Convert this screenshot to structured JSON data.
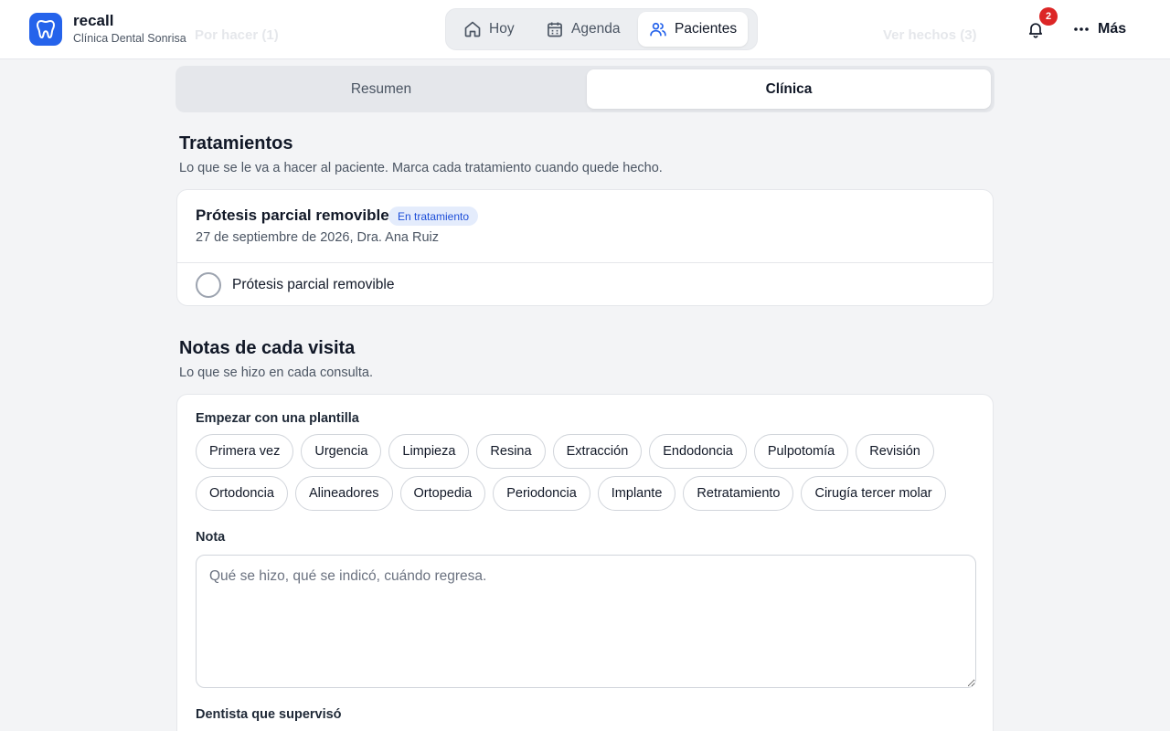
{
  "app": {
    "name": "recall",
    "clinic": "Clínica Dental Sonrisa"
  },
  "background": {
    "behind_left": "Por hacer (1)",
    "behind_right": "Ver hechos (3)"
  },
  "nav": {
    "items": [
      {
        "label": "Hoy",
        "icon": "home-icon"
      },
      {
        "label": "Agenda",
        "icon": "calendar-icon"
      },
      {
        "label": "Pacientes",
        "icon": "users-icon",
        "active": true
      }
    ]
  },
  "header_right": {
    "notifications_count": "2",
    "more_label": "Más"
  },
  "tabs": [
    {
      "label": "Resumen",
      "active": false
    },
    {
      "label": "Clínica",
      "active": true
    }
  ],
  "treatments": {
    "title": "Tratamientos",
    "subtitle": "Lo que se le va a hacer al paciente. Marca cada tratamiento cuando quede hecho.",
    "card": {
      "name": "Prótesis parcial removible",
      "status": "En tratamiento",
      "meta": "27 de septiembre de 2026, Dra. Ana Ruiz",
      "items": [
        {
          "label": "Prótesis parcial removible",
          "done": false
        }
      ]
    }
  },
  "notes": {
    "title": "Notas de cada visita",
    "subtitle": "Lo que se hizo en cada consulta.",
    "template_label": "Empezar con una plantilla",
    "templates": [
      "Primera vez",
      "Urgencia",
      "Limpieza",
      "Resina",
      "Extracción",
      "Endodoncia",
      "Pulpotomía",
      "Revisión",
      "Ortodoncia",
      "Alineadores",
      "Ortopedia",
      "Periodoncia",
      "Implante",
      "Retratamiento",
      "Cirugía tercer molar"
    ],
    "note_label": "Nota",
    "note_placeholder": "Qué se hizo, qué se indicó, cuándo regresa.",
    "note_value": "",
    "supervisor_label": "Dentista que supervisó"
  },
  "colors": {
    "brand": "#2563eb",
    "badge_alert": "#dc2626",
    "status_badge_bg": "#e4ecfc",
    "status_badge_text": "#1d4ed8",
    "page_bg": "#f3f4f6"
  }
}
